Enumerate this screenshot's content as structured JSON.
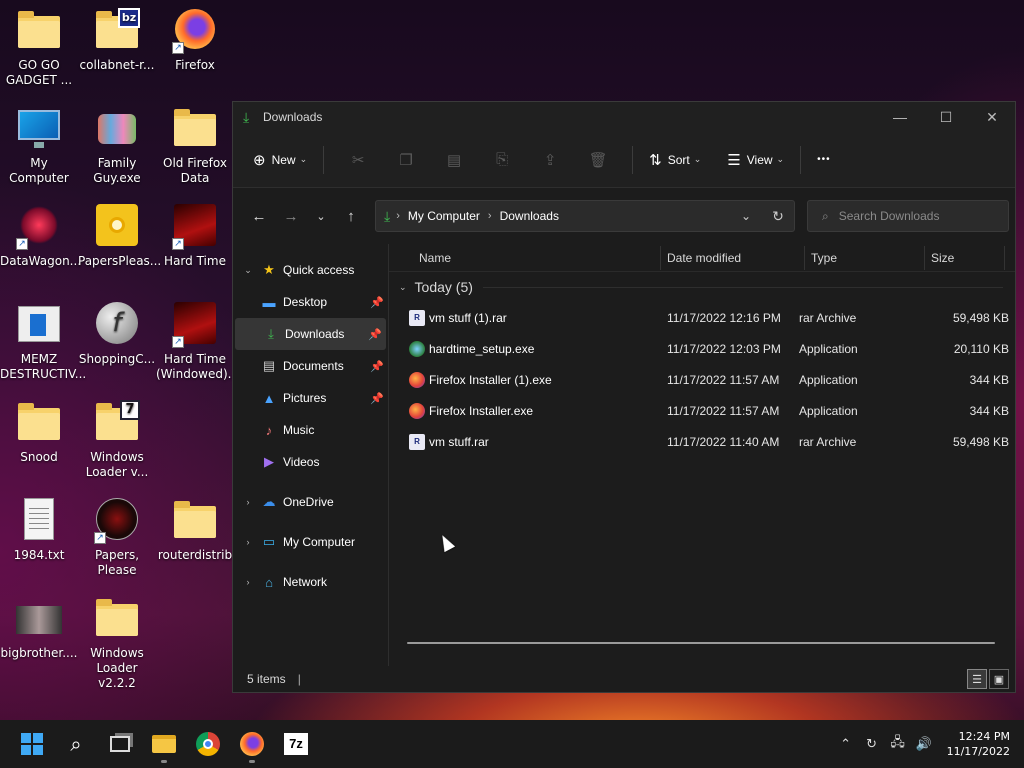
{
  "desktop": {
    "icons": [
      {
        "label": "GO GO\nGADGET ...",
        "icon": "folder-icon"
      },
      {
        "label": "collabnet-r...",
        "icon": "folder-bz-icon"
      },
      {
        "label": "Firefox",
        "icon": "firefox-icon"
      },
      {
        "label": "My Computer",
        "icon": "monitor-icon"
      },
      {
        "label": "Family\nGuy.exe",
        "icon": "family-guy-icon"
      },
      {
        "label": "Old Firefox\nData",
        "icon": "folder-icon"
      },
      {
        "label": "DataWagon...",
        "icon": "datawagon-icon"
      },
      {
        "label": "PapersPleas...",
        "icon": "disc-icon"
      },
      {
        "label": "Hard Time",
        "icon": "hard-time-icon"
      },
      {
        "label": "MEMZ\nDESTRUCTIV...",
        "icon": "memz-icon"
      },
      {
        "label": "ShoppingC...",
        "icon": "flash-icon"
      },
      {
        "label": "Hard Time\n(Windowed)...",
        "icon": "hard-time-icon"
      },
      {
        "label": "Snood",
        "icon": "folder-icon"
      },
      {
        "label": "Windows\nLoader v...",
        "icon": "folder-7-icon"
      },
      {
        "label": "1984.txt",
        "icon": "text-file-icon"
      },
      {
        "label": "Papers, Please",
        "icon": "papers-please-icon"
      },
      {
        "label": "routerdistrib",
        "icon": "folder-icon"
      },
      {
        "label": "bigbrother....",
        "icon": "face-image-icon"
      },
      {
        "label": "Windows\nLoader v2.2.2",
        "icon": "folder-icon"
      }
    ]
  },
  "window": {
    "title": "Downloads",
    "controls": {
      "minimize": "—",
      "maximize": "☐",
      "close": "✕"
    },
    "commands": {
      "new_label": "New",
      "sort_label": "Sort",
      "view_label": "View",
      "more_label": "•••"
    },
    "address": {
      "crumbs": [
        "My Computer",
        "Downloads"
      ],
      "search_placeholder": "Search Downloads"
    },
    "sidebar": {
      "quick_access": "Quick access",
      "items": [
        {
          "label": "Desktop",
          "pinned": true
        },
        {
          "label": "Downloads",
          "pinned": true
        },
        {
          "label": "Documents",
          "pinned": true
        },
        {
          "label": "Pictures",
          "pinned": true
        },
        {
          "label": "Music",
          "pinned": false
        },
        {
          "label": "Videos",
          "pinned": false
        }
      ],
      "roots": [
        "OneDrive",
        "My Computer",
        "Network"
      ]
    },
    "columns": [
      "Name",
      "Date modified",
      "Type",
      "Size"
    ],
    "group_label": "Today (5)",
    "files": [
      {
        "name": "vm stuff (1).rar",
        "date": "11/17/2022 12:16 PM",
        "type": "rar Archive",
        "size": "59,498 KB",
        "icon": "rar-icon"
      },
      {
        "name": "hardtime_setup.exe",
        "date": "11/17/2022 12:03 PM",
        "type": "Application",
        "size": "20,110 KB",
        "icon": "installer-icon"
      },
      {
        "name": "Firefox Installer (1).exe",
        "date": "11/17/2022 11:57 AM",
        "type": "Application",
        "size": "344 KB",
        "icon": "firefox-installer-icon"
      },
      {
        "name": "Firefox Installer.exe",
        "date": "11/17/2022 11:57 AM",
        "type": "Application",
        "size": "344 KB",
        "icon": "firefox-installer-icon"
      },
      {
        "name": "vm stuff.rar",
        "date": "11/17/2022 11:40 AM",
        "type": "rar Archive",
        "size": "59,498 KB",
        "icon": "rar-icon"
      }
    ],
    "status": {
      "count": "5 items"
    }
  },
  "taskbar": {
    "apps": [
      "start-icon",
      "search-icon",
      "task-view-icon",
      "file-explorer-icon",
      "chrome-icon",
      "firefox-icon",
      "7zip-icon"
    ],
    "clock": {
      "time": "12:24 PM",
      "date": "11/17/2022"
    }
  },
  "colors": {
    "accent": "#3fb950",
    "window_bg": "#1c1c1c",
    "taskbar_bg": "#1b1b1b"
  }
}
